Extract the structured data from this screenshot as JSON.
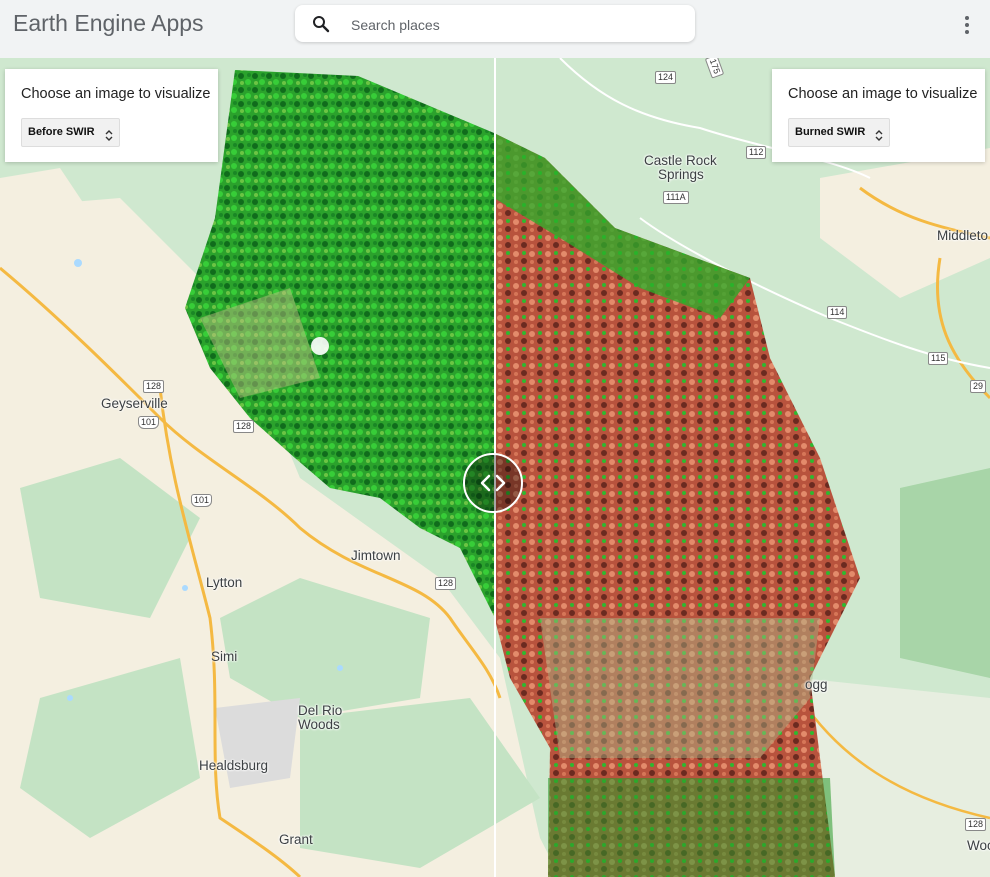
{
  "app": {
    "title": "Earth Engine Apps"
  },
  "search": {
    "placeholder": "Search places",
    "value": ""
  },
  "icons": {
    "search": "search-icon",
    "menu": "more-vert-icon",
    "swipe": "chevrons-left-right-icon",
    "select": "select-arrows-icon"
  },
  "left_panel": {
    "title": "Choose an image to visualize",
    "selected": "Before SWIR"
  },
  "right_panel": {
    "title": "Choose an image to visualize",
    "selected": "Burned SWIR"
  },
  "map": {
    "places": {
      "geyserville": "Geyserville",
      "jimtown": "Jimtown",
      "lytton": "Lytton",
      "simi": "Simi",
      "del_rio_woods_1": "Del Rio",
      "del_rio_woods_2": "Woods",
      "healdsburg": "Healdsburg",
      "grant": "Grant",
      "castle_rock_1": "Castle Rock",
      "castle_rock_2": "Springs",
      "middletown": "Middleto",
      "ogg": "ogg",
      "woo": "Woo"
    },
    "routes": {
      "r124": "124",
      "r112": "112",
      "r111a": "111A",
      "r114": "114",
      "r115": "115",
      "r29": "29",
      "r128a": "128",
      "r128b": "128",
      "r128c": "128",
      "r128d": "128",
      "r101a": "101",
      "r101b": "101",
      "r175": "175"
    }
  },
  "colors": {
    "water": "#aadaff",
    "land": "#f8f3e4",
    "park": "#c6e8c6",
    "highway": "#f4b942",
    "before_vegetation": "#2fb82f",
    "burned": "#c2654a"
  }
}
